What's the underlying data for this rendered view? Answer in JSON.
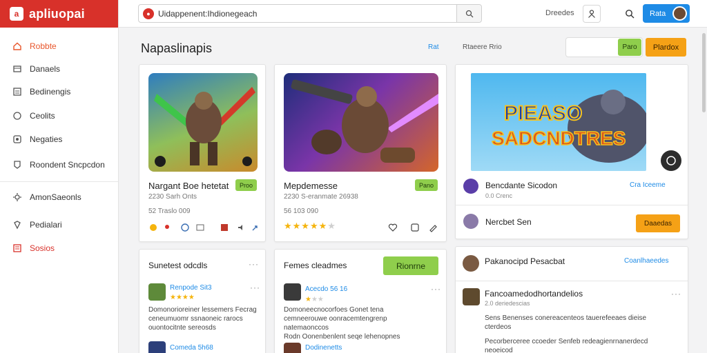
{
  "brand": {
    "name": "apliuopai",
    "logo_letter": "a"
  },
  "sidebar": {
    "items": [
      {
        "label": "Robbte",
        "icon": "home-icon"
      },
      {
        "label": "Danaels",
        "icon": "folder-icon"
      },
      {
        "label": "Bedinengis",
        "icon": "list-icon"
      },
      {
        "label": "Ceolits",
        "icon": "chat-icon"
      },
      {
        "label": "Negaties",
        "icon": "tag-icon"
      },
      {
        "label": "Roondent Sncpcdon",
        "icon": "shield-icon"
      },
      {
        "label": "AmonSaeonls",
        "icon": "gear-icon"
      },
      {
        "label": "Pedialari",
        "icon": "puzzle-icon"
      },
      {
        "label": "Sosios",
        "icon": "bars-icon"
      }
    ]
  },
  "topbar": {
    "search_value": "Uidappenent:Ihdionegeach",
    "link": "Dreedes",
    "user_button": "Rata"
  },
  "header": {
    "title": "Napaslinapis",
    "link1": "Rat",
    "link2": "Rtaeere Rrio",
    "green_btn": "Paro",
    "orange_btn": "Plardox"
  },
  "cards": [
    {
      "title": "Nargant Boe hetetat",
      "tag": "Proo",
      "meta1": "2230 Sarh Onts",
      "meta2": "52 Traslo 009",
      "rating": 0
    },
    {
      "title": "Mepdemesse",
      "tag": "Pano",
      "meta1": "2230 S-eranmate 26938",
      "meta2": "56 103 090",
      "rating": 5
    }
  ],
  "featured": {
    "line1": "PIEASO",
    "line2": "SADCNDTRES",
    "name": "Bencdante Sicodon",
    "link": "Cra Iceeme",
    "meta": "0.0 Crenc",
    "sub_name": "Nercbet Sen",
    "orange_btn": "Daaedas"
  },
  "reviews_left": {
    "heading": "Sunetest odcdls",
    "items": [
      {
        "name": "Renpode Sit3",
        "text": "Domonorioreiner lessemers Fecrag\nceneumuomr ssnaoneic rarocs\nouontocitnte sereosds"
      },
      {
        "name": "Comeda 5h68",
        "text": ""
      }
    ]
  },
  "reviews_mid": {
    "heading": "Femes cleadmes",
    "btn": "Rionrne",
    "items": [
      {
        "name": "Acecdo 56 16",
        "text": "Domoneecnocorfoes Gonet tena\ncemneerouwe oonracemtengrenp\nnatemaonccos\nRodn Oonenbenlent seqe lehenopnes"
      },
      {
        "name": "Dodinenetts",
        "text": ""
      }
    ]
  },
  "right_panel": {
    "name": "Pakanocipd Pesacbat",
    "link": "Coanlhaeedes",
    "review": {
      "name": "Fancoamedodhortandelios",
      "meta": "2.0 deriedescias",
      "text1": "Sens Benenses conereacenteos tauerefeeaes dieise\ncterdeos",
      "text2": "Pecorberceree ccoeder Senfeb redeagienrnanerdecd\nneoeicod"
    }
  },
  "colors": {
    "brand": "#d8312a",
    "accent": "#1e8be6",
    "orange": "#f5a116",
    "green": "#8fce4c",
    "star": "#f5b40d"
  }
}
